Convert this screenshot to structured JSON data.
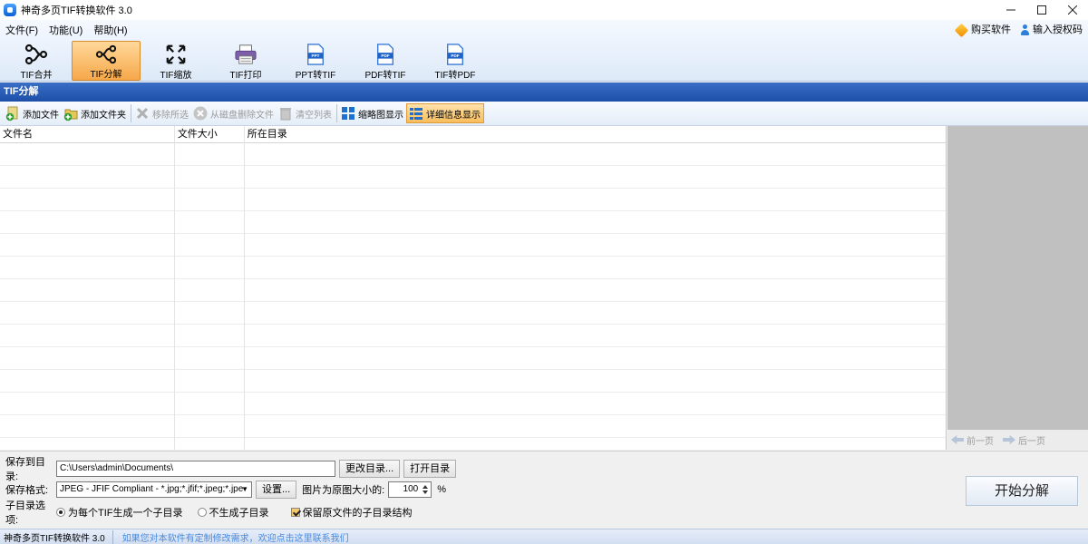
{
  "window": {
    "title": "神奇多页TIF转换软件 3.0",
    "controls": [
      "minimize-icon",
      "maximize-icon",
      "close-icon"
    ]
  },
  "menu": {
    "items": [
      "文件(F)",
      "功能(U)",
      "帮助(H)"
    ]
  },
  "header_links": {
    "buy": "购买软件",
    "license": "输入授权码"
  },
  "main_toolbar": {
    "items": [
      {
        "label": "TIF合并",
        "icon": "merge-icon"
      },
      {
        "label": "TIF分解",
        "icon": "split-icon",
        "active": true
      },
      {
        "label": "TIF缩放",
        "icon": "resize-icon"
      },
      {
        "label": "TIF打印",
        "icon": "printer-icon"
      },
      {
        "label": "PPT转TIF",
        "icon": "ppt-file-icon",
        "badge": "PPT"
      },
      {
        "label": "PDF转TIF",
        "icon": "pdf-file-icon",
        "badge": "PDF"
      },
      {
        "label": "TIF转PDF",
        "icon": "pdf-file-icon",
        "badge": "PDF"
      }
    ]
  },
  "section": {
    "title": "TIF分解"
  },
  "sub_toolbar": {
    "add_file": "添加文件",
    "add_folder": "添加文件夹",
    "remove_selected": "移除所选",
    "delete_from_disk": "从磁盘删除文件",
    "clear_list": "清空列表",
    "thumbnail_view": "缩略图显示",
    "detail_view": "详细信息显示"
  },
  "table": {
    "columns": [
      "文件名",
      "文件大小",
      "所在目录"
    ],
    "rows": []
  },
  "pager": {
    "prev": "前一页",
    "next": "后一页"
  },
  "options": {
    "save_dir_label": "保存到目录:",
    "save_dir_value": "C:\\Users\\admin\\Documents\\",
    "change_dir": "更改目录...",
    "open_dir": "打开目录",
    "format_label": "保存格式:",
    "format_value": "JPEG - JFIF Compliant - *.jpg;*.jfif;*.jpeg;*.jpe",
    "settings": "设置...",
    "size_label": "图片为原图大小的:",
    "size_value": "100",
    "size_unit": "%",
    "subdir_label": "子目录选项:",
    "radio_per_tif": "为每个TIF生成一个子目录",
    "radio_no_subdir": "不生成子目录",
    "keep_structure": "保留原文件的子目录结构",
    "start_button": "开始分解"
  },
  "status": {
    "app_name": "神奇多页TIF转换软件 3.0",
    "contact_link": "如果您对本软件有定制修改需求，欢迎点击这里联系我们"
  },
  "colors": {
    "section_header": "#1d4fa8",
    "active_tool": "#f6a84a",
    "link": "#4a8be0"
  }
}
